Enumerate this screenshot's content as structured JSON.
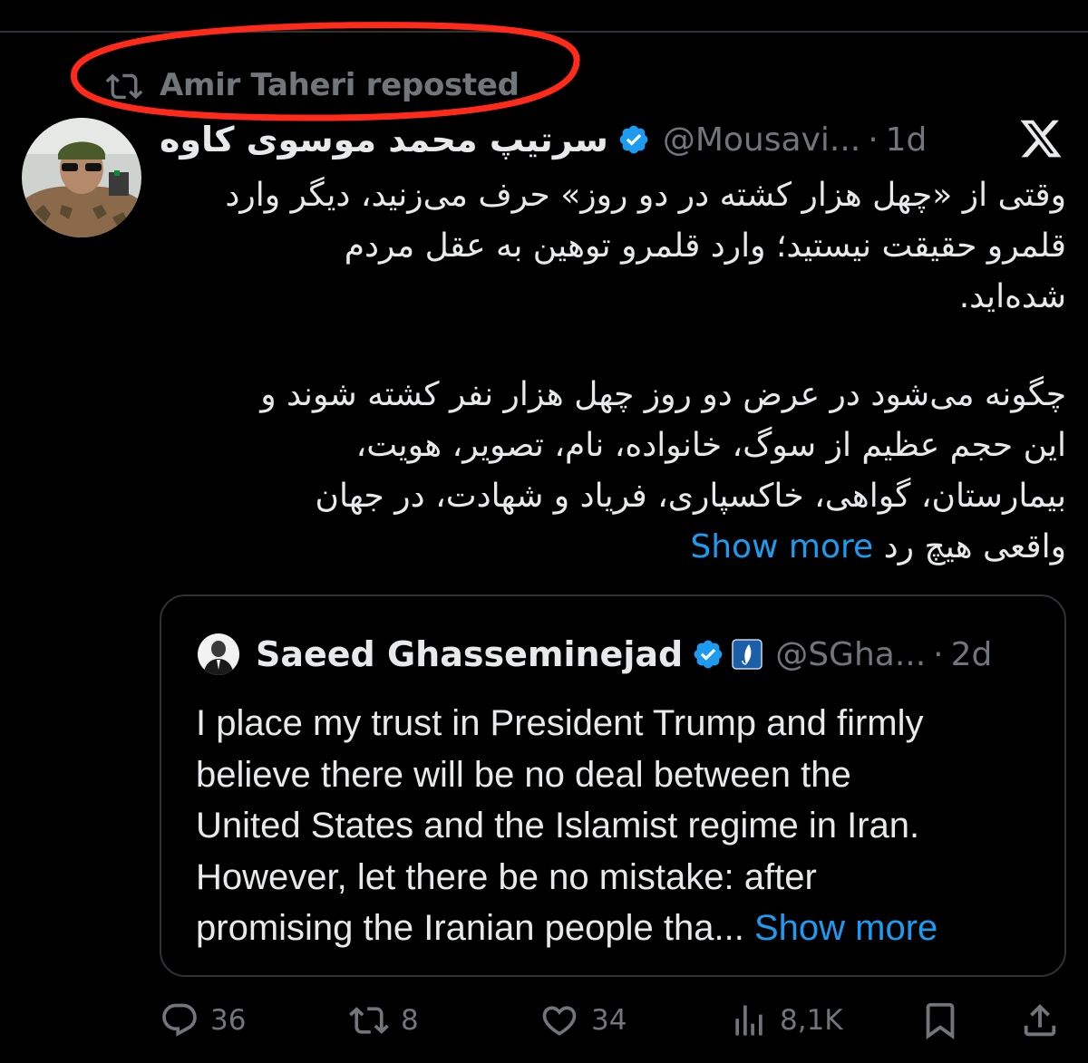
{
  "repost": {
    "label": "Amir Taheri reposted"
  },
  "tweet": {
    "author_name": "سرتیپ محمد موسوی کاوه",
    "handle": "@Mousavi...",
    "separator": "·",
    "time": "1d",
    "body_lines": [
      "وقتی از «چهل هزار کشته در دو روز» حرف می‌زنید، دیگر وارد",
      "قلمرو حقیقت نیستید؛ وارد قلمرو توهین به عقل مردم",
      "شده‌اید.",
      "چگونه می‌شود در عرض دو روز چهل هزار نفر کشته شوند و",
      "این حجم عظیم از سوگ، خانواده، نام، تصویر، هویت،",
      "بیمارستان، گواهی، خاکسپاری، فریاد و شهادت، در جهان"
    ],
    "last_line": "واقعی هیچ رد",
    "show_more": "Show more"
  },
  "quote": {
    "author_name": "Saeed Ghasseminejad",
    "handle": "@SGha...",
    "separator": "·",
    "time": "2d",
    "text_lines": [
      "I place my trust in President Trump and firmly",
      "believe there will be no deal between the",
      "United States and the Islamist regime in Iran.",
      "However, let there be no mistake: after"
    ],
    "last_line": "promising the Iranian people tha...",
    "show_more": "Show more"
  },
  "actions": {
    "replies": "36",
    "reposts": "8",
    "likes": "34",
    "views": "8,1K"
  },
  "icons": {
    "repost": "repost-icon",
    "verified": "verified-badge-icon",
    "x_logo": "x-logo-icon",
    "reply": "reply-icon",
    "like": "heart-icon",
    "views": "views-icon",
    "bookmark": "bookmark-icon",
    "share": "share-icon"
  },
  "colors": {
    "background": "#000000",
    "text": "#e7e9ea",
    "secondary": "#71767b",
    "link": "#1d9bf0",
    "annotation": "#ff2a1a"
  }
}
